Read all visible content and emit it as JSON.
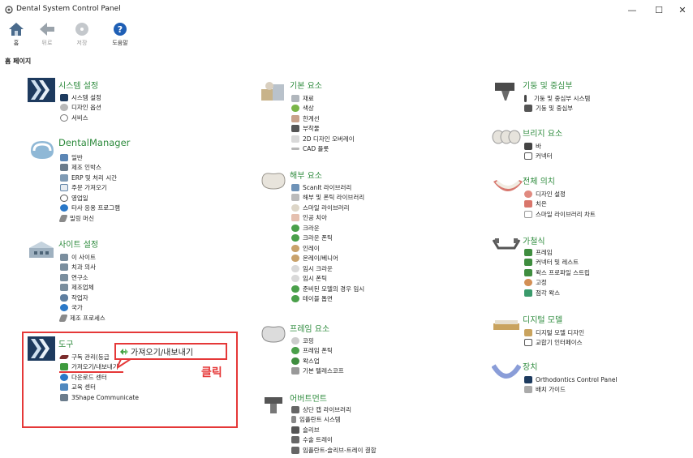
{
  "window": {
    "title": "Dental System Control Panel",
    "controls": {
      "minimize": "—",
      "maximize": "☐",
      "close": "✕"
    }
  },
  "toolbar": {
    "home": "홈",
    "back": "뒤로",
    "save": "저장",
    "help": "도움말"
  },
  "page_label": "홈 페이지",
  "groups": {
    "system": {
      "title": "시스템 설정",
      "items": [
        "시스템 설정",
        "디자인 옵션",
        "서비스"
      ]
    },
    "dentalmanager": {
      "title": "DentalManager",
      "items": [
        "일반",
        "제조 인박스",
        "ERP 및 처리 시간",
        "주문 가져오기",
        "영업일",
        "타사 응용 프로그램",
        "밀링 머신"
      ]
    },
    "site": {
      "title": "사이트 설정",
      "items": [
        "이 사이트",
        "치과 의사",
        "연구소",
        "제조업체",
        "작업자",
        "국가",
        "제조 프로세스"
      ]
    },
    "tools": {
      "title": "도구",
      "items": [
        "구독 관리(등급",
        "가져오기/내보내기",
        "다운로드 센터",
        "교육 센터",
        "3Shape Communicate"
      ]
    },
    "basic": {
      "title": "기본 요소",
      "items": [
        "재료",
        "색상",
        "한계선",
        "부착물",
        "2D 디자인 오버레이",
        "CAD 플롯"
      ]
    },
    "anatomy": {
      "title": "해부 요소",
      "items": [
        "ScanIt 라이브러리",
        "해부 및 폰틱 라이브러리",
        "스마일 라이브러리",
        "인공 치아",
        "크라운",
        "크라운 폰틱",
        "인레이",
        "온레이/베니어",
        "임시 크라운",
        "임시 폰틱",
        "준비된 모델의 경우 임시",
        "테이블 톱면"
      ]
    },
    "frame": {
      "title": "프레임 요소",
      "items": [
        "코핑",
        "프레임 폰틱",
        "왁스업",
        "기본 텔레스코프"
      ]
    },
    "abutment": {
      "title": "어버트먼트",
      "items": [
        "상단 캡 라이브러리",
        "임플란트 시스템",
        "슬리브",
        "수술 트레이",
        "임플란트-슬리브-트레이 결합"
      ]
    },
    "post": {
      "title": "기둥 및 중심부",
      "items": [
        "기둥 및 중심부 시스템",
        "기둥 및 중심부"
      ]
    },
    "bridge": {
      "title": "브리지 요소",
      "items": [
        "바",
        "커넥터"
      ]
    },
    "denture": {
      "title": "전체 의치",
      "items": [
        "디자인 설정",
        "치은",
        "스마일 라이브러리 차트"
      ]
    },
    "partial": {
      "title": "가철식",
      "items": [
        "프레임",
        "커넥터 및 레스트",
        "왁스 프로파일 스트립",
        "고정",
        "점각 왁스"
      ]
    },
    "digital": {
      "title": "디지털 모델",
      "items": [
        "디지털 모델 디자인",
        "교합기 인터페이스"
      ]
    },
    "device": {
      "title": "장치",
      "items": [
        "Orthodontics Control Panel",
        "배치 가이드"
      ]
    }
  },
  "annotation": {
    "callout": "가져오기/내보내기",
    "click_label": "클릭",
    "color": "#e53838"
  },
  "colors": {
    "group_title": "#2e8b3d",
    "highlight": "#e53838"
  }
}
